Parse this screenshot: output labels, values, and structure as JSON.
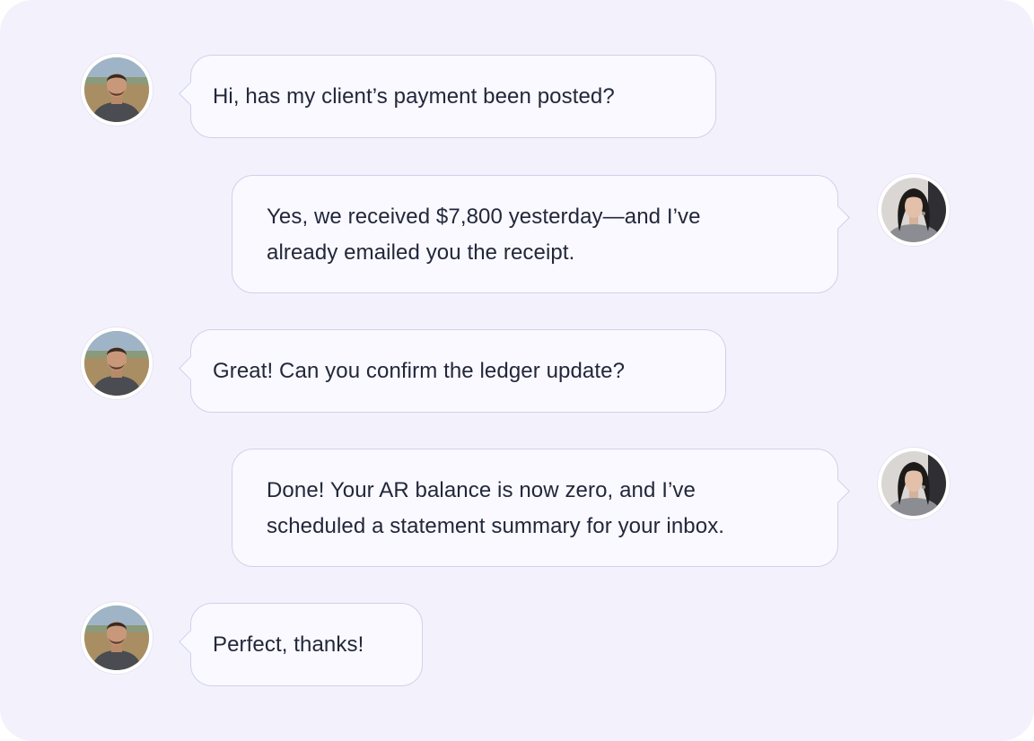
{
  "messages": [
    {
      "sender": "client",
      "avatar_icon": "man-avatar-icon",
      "text": "Hi, has my client’s payment been posted?"
    },
    {
      "sender": "agent",
      "avatar_icon": "woman-avatar-icon",
      "lines": [
        "Yes, we received $7,800 yesterday—and I’ve",
        "already emailed you the receipt."
      ]
    },
    {
      "sender": "client",
      "avatar_icon": "man-avatar-icon",
      "text": "Great! Can you confirm the ledger update?"
    },
    {
      "sender": "agent",
      "avatar_icon": "woman-avatar-icon",
      "lines": [
        "Done! Your AR balance is now zero, and I’ve",
        "scheduled a statement summary for your inbox."
      ]
    },
    {
      "sender": "client",
      "avatar_icon": "man-avatar-icon",
      "text": "Perfect, thanks!"
    }
  ],
  "colors": {
    "panel_background": "#f3f2fc",
    "bubble_background": "#f9f9ff",
    "bubble_border": "#cfd2ea",
    "text": "#22273a"
  }
}
